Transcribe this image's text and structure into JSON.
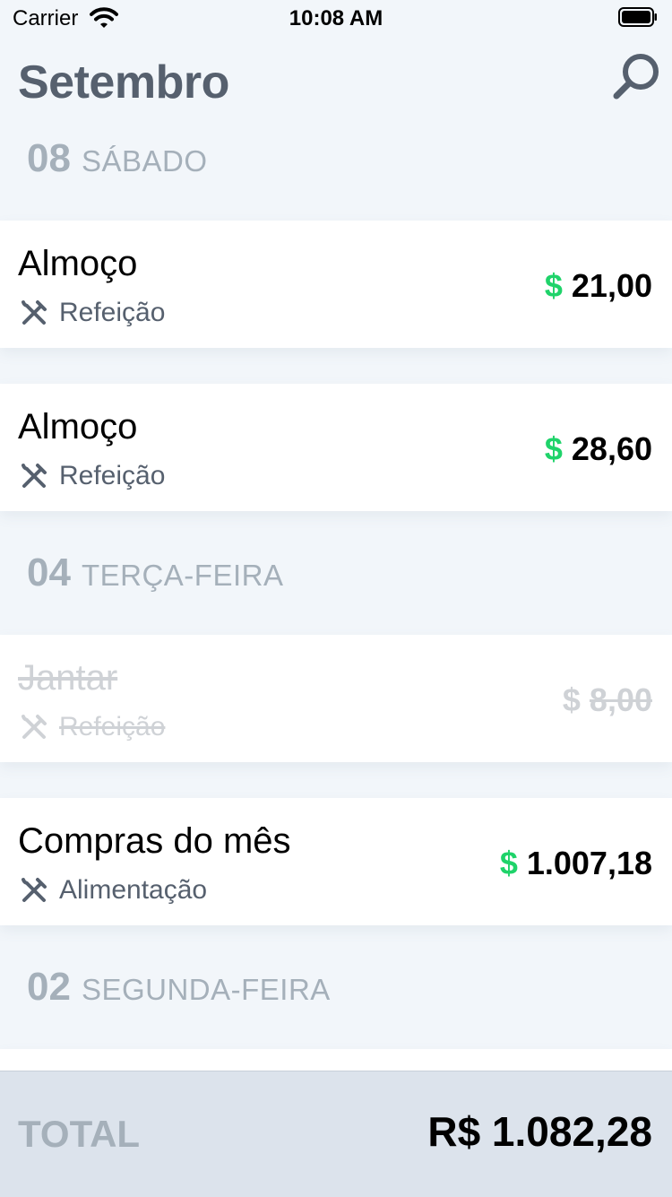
{
  "status_bar": {
    "carrier": "Carrier",
    "time": "10:08 AM"
  },
  "header": {
    "title": "Setembro",
    "search_icon": "search-icon"
  },
  "sections": [
    {
      "day": "08",
      "weekday": "SÁBADO",
      "items": [
        {
          "title": "Almoço",
          "category": "Refeição",
          "currency": "$",
          "amount": "21,00",
          "disabled": false
        },
        {
          "title": "Almoço",
          "category": "Refeição",
          "currency": "$",
          "amount": "28,60",
          "disabled": false
        }
      ]
    },
    {
      "day": "04",
      "weekday": "TERÇA-FEIRA",
      "items": [
        {
          "title": "Jantar",
          "category": "Refeição",
          "currency": "$",
          "amount": "8,00",
          "disabled": true
        },
        {
          "title": "Compras do mês",
          "category": "Alimentação",
          "currency": "$",
          "amount": "1.007,18",
          "disabled": false
        }
      ]
    },
    {
      "day": "02",
      "weekday": "SEGUNDA-FEIRA",
      "items": []
    }
  ],
  "footer": {
    "label": "TOTAL",
    "value": "R$ 1.082,28"
  },
  "colors": {
    "accent_green": "#1fd36a",
    "title_gray": "#56606e",
    "muted_gray": "#a5b0ba",
    "background": "#f2f6fa",
    "footer_bg": "#dce3ec"
  },
  "category_icon": "fork-knife-icon"
}
